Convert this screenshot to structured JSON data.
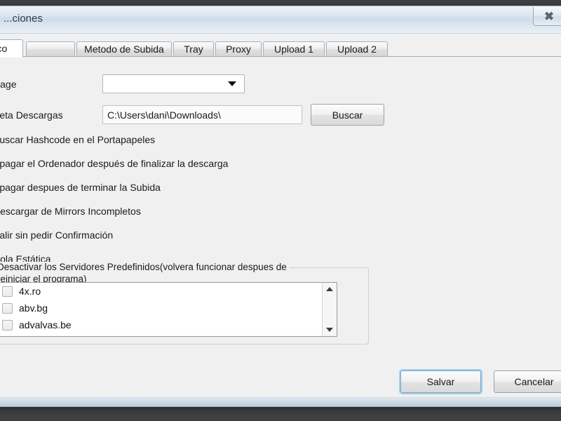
{
  "window": {
    "title": "...ciones",
    "close_label": "✖"
  },
  "tabs": [
    {
      "label": "ásico",
      "active": true
    },
    {
      "label": "",
      "active": false
    },
    {
      "label": "Metodo de Subida",
      "active": false
    },
    {
      "label": "Tray",
      "active": false
    },
    {
      "label": "Proxy",
      "active": false
    },
    {
      "label": "Upload 1",
      "active": false
    },
    {
      "label": "Upload 2",
      "active": false
    }
  ],
  "form": {
    "language_label": "anguage",
    "language_value": "",
    "folder_label": "Carpeta Descargas",
    "folder_value": "C:\\Users\\dani\\Downloads\\",
    "browse_label": "Buscar"
  },
  "checkboxes": [
    {
      "label": "Buscar Hashcode en el Portapapeles",
      "checked": true
    },
    {
      "label": "Apagar el Ordenador después de finalizar la descarga",
      "checked": false
    },
    {
      "label": "Apagar despues de terminar la Subida",
      "checked": false
    },
    {
      "label": "Descargar de Mirrors Incompletos",
      "checked": true
    },
    {
      "label": "Salir sin pedir Confirmación",
      "checked": false
    },
    {
      "label": "Cola Estática",
      "checked": false
    }
  ],
  "servers_group": {
    "title_line1": "Desactivar los Servidores Predefinidos(volvera  funcionar despues de",
    "title_line2": "reiniciar el programa)",
    "items": [
      {
        "label": "4x.ro",
        "checked": false
      },
      {
        "label": "abv.bg",
        "checked": false
      },
      {
        "label": "advalvas.be",
        "checked": false
      }
    ],
    "scroll_up": "▲",
    "scroll_down": "▼"
  },
  "footer": {
    "save_label": "Salvar",
    "cancel_label": "Cancelar"
  },
  "colors": {
    "accent": "#9fd0ea",
    "titlebar": "#ccdbe8",
    "check": "#3a6fa8"
  }
}
